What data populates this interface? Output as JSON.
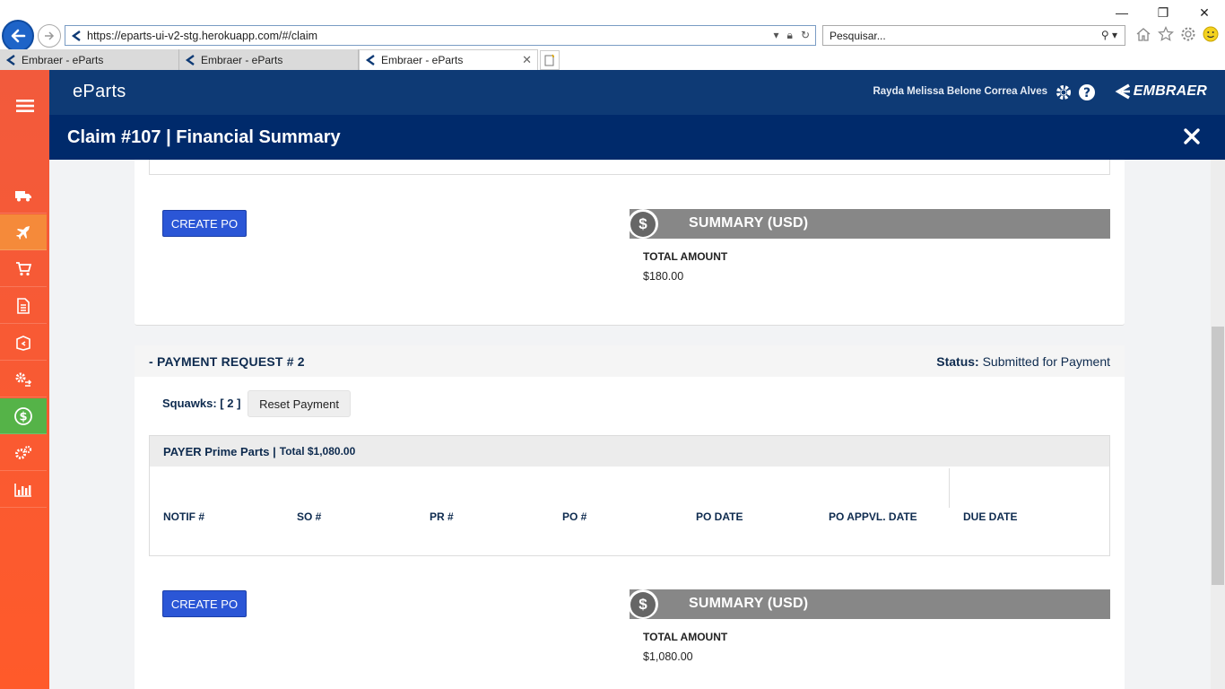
{
  "browser": {
    "url": "https://eparts-ui-v2-stg.herokuapp.com/#/claim",
    "search_placeholder": "Pesquisar...",
    "tabs": [
      {
        "label": "Embraer - eParts"
      },
      {
        "label": "Embraer - eParts"
      },
      {
        "label": "Embraer - eParts"
      }
    ],
    "window_controls": {
      "minimize": "—",
      "restore": "❐",
      "close": "✕"
    }
  },
  "app": {
    "logo": "eParts",
    "user_name": "Rayda Melissa Belone Correa Alves",
    "brand": "EMBRAER",
    "page_title": "Claim #107 | Financial Summary"
  },
  "sidebar": {
    "items": [
      {
        "icon": "truck-icon"
      },
      {
        "icon": "airplane-icon"
      },
      {
        "icon": "cart-icon"
      },
      {
        "icon": "document-icon"
      },
      {
        "icon": "box-return-icon"
      },
      {
        "icon": "gears-exchange-icon"
      },
      {
        "icon": "dollar-circle-icon"
      },
      {
        "icon": "cogs-icon"
      },
      {
        "icon": "bar-chart-icon"
      }
    ]
  },
  "section1": {
    "create_po_label": "CREATE PO",
    "summary_title": "SUMMARY (USD)",
    "total_amount_label": "TOTAL AMOUNT",
    "total_amount_value": "$180.00"
  },
  "payment_request": {
    "title": "- PAYMENT REQUEST # 2",
    "status_label": "Status:",
    "status_value": "Submitted for Payment",
    "squawks": "Squawks: [ 2 ]",
    "reset_label": "Reset Payment",
    "payer_name": "PAYER Prime Parts |",
    "payer_total": "Total $1,080.00",
    "columns": [
      "NOTIF #",
      "SO #",
      "PR #",
      "PO #",
      "PO DATE",
      "PO APPVL. DATE",
      "DUE DATE"
    ],
    "create_po_label": "CREATE PO",
    "summary_title": "SUMMARY (USD)",
    "total_amount_label": "TOTAL AMOUNT",
    "total_amount_value": "$1,080.00"
  },
  "colors": {
    "header": "#0e3a75",
    "title_bar": "#002a6b",
    "sidebar": "#f25a3c",
    "button": "#2b56d6",
    "summary_bar": "#878787"
  }
}
